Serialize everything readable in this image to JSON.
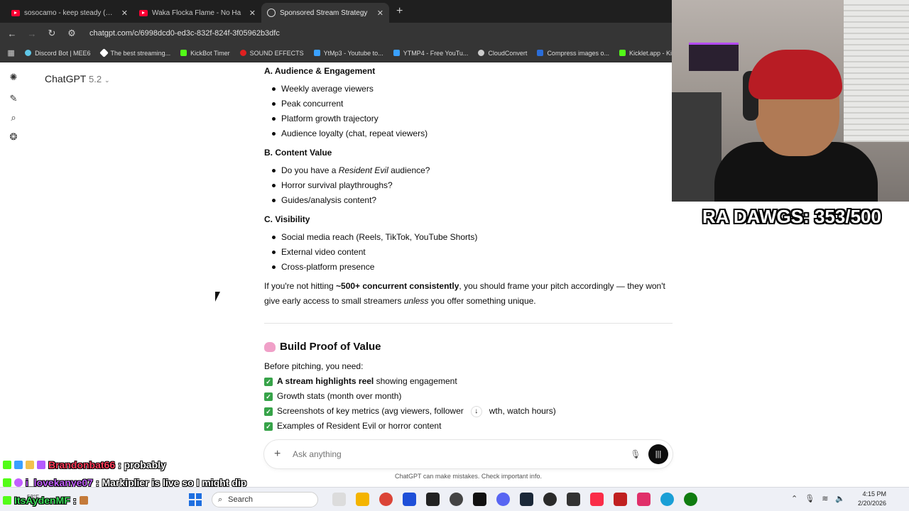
{
  "browser": {
    "tabs": [
      {
        "title": "sosocamo - keep steady (Offici",
        "icon": "youtube-icon"
      },
      {
        "title": "Waka Flocka Flame - No Ha",
        "icon": "youtube-icon"
      },
      {
        "title": "Sponsored Stream Strategy",
        "icon": "chatgpt-icon",
        "active": true
      }
    ],
    "url": "chatgpt.com/c/6998dcd0-ed3c-832f-824f-3f05962b3dfc",
    "bookmarks": [
      {
        "label": "Discord Bot | MEE6",
        "color": "#5fc7e8"
      },
      {
        "label": "The best streaming...",
        "color": "#ffffff"
      },
      {
        "label": "KickBot Timer",
        "color": "#53fc18"
      },
      {
        "label": "SOUND EFFECTS",
        "color": "#e02020"
      },
      {
        "label": "YtMp3 - Youtube to...",
        "color": "#3aa0ff"
      },
      {
        "label": "YTMP4 - Free YouTu...",
        "color": "#3aa0ff"
      },
      {
        "label": "CloudConvert",
        "color": "#cccccc"
      },
      {
        "label": "Compress images o...",
        "color": "#2a6dd9"
      },
      {
        "label": "Kicklet.app - Ki",
        "color": "#53fc18"
      }
    ]
  },
  "sidebar": {
    "model_name": "ChatGPT",
    "model_version": "5.2",
    "icons": [
      "chatgpt-logo-icon",
      "new-chat-icon",
      "search-icon",
      "library-icon"
    ]
  },
  "content": {
    "sectionA": {
      "heading": "A. Audience & Engagement",
      "items": [
        "Weekly average viewers",
        "Peak concurrent",
        "Platform growth trajectory",
        "Audience loyalty (chat, repeat viewers)"
      ]
    },
    "sectionB": {
      "heading": "B. Content Value",
      "item1_pre": "Do you have a ",
      "item1_em": "Resident Evil",
      "item1_post": " audience?",
      "items": [
        "Horror survival playthroughs?",
        "Guides/analysis content?"
      ]
    },
    "sectionC": {
      "heading": "C. Visibility",
      "items": [
        "Social media reach (Reels, TikTok, YouTube Shorts)",
        "External video content",
        "Cross-platform presence"
      ]
    },
    "paragraph": {
      "p1": "If you're not hitting ",
      "bold": "~500+ concurrent consistently",
      "p2": ", you should frame your pitch accordingly — they won't give early access to small streamers ",
      "em": "unless",
      "p3": " you offer something unique."
    },
    "proof": {
      "heading": "Build Proof of Value",
      "intro": "Before pitching, you need:",
      "check1_bold": "A stream highlights reel",
      "check1_rest": " showing engagement",
      "check2": "Growth stats (month over month)",
      "check3_a": "Screenshots of key metrics (avg viewers, follower",
      "check3_b": "wth, watch hours)",
      "check4": "Examples of Resident Evil or horror content"
    }
  },
  "composer": {
    "placeholder": "Ask anything",
    "disclaimer": "ChatGPT can make mistakes. Check important info."
  },
  "overlay": {
    "goal_text": "RA DAWGS: 353/500",
    "chat": [
      {
        "user": "Brandonbat66",
        "color": "#ff3d5a",
        "message": ": probably"
      },
      {
        "user": "i_lovekanye07",
        "color": "#c25fff",
        "message": ": Markiplier is live so I might dip"
      },
      {
        "user": "ItsAydenMF",
        "color": "#3ddc5a",
        "message": ":"
      }
    ]
  },
  "taskbar": {
    "search_label": "Search",
    "weather": "53°F",
    "time": "4:15 PM",
    "date": "2/20/2026"
  }
}
